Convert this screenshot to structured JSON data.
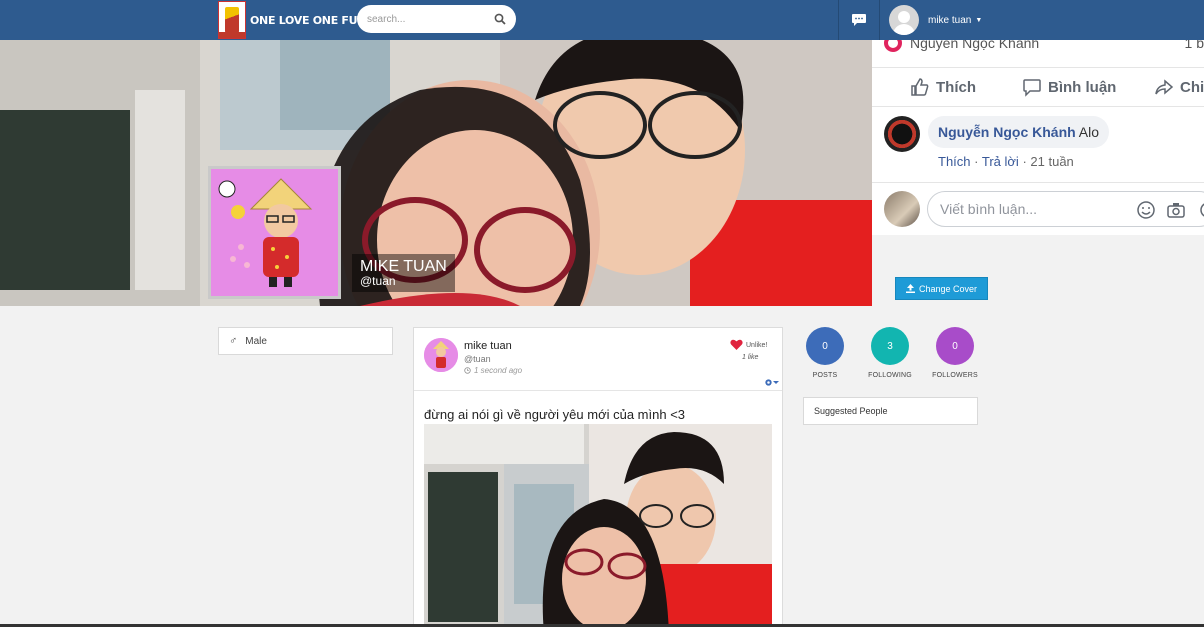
{
  "navbar": {
    "logo_text": "ONE LOVE ONE FUTURE",
    "search_placeholder": "search...",
    "user_name": "mike tuan",
    "colors": {
      "bar": "#2e5b8f"
    }
  },
  "profile": {
    "name": "MIKE TUAN",
    "handle": "@tuan",
    "change_cover_label": "Change Cover",
    "gender": "Male"
  },
  "fb_snippet": {
    "top_name": "Nguyễn Ngọc Khánh",
    "top_right": "1 b",
    "actions": [
      "Thích",
      "Bình luận",
      "Chi"
    ],
    "comment_author": "Nguyễn Ngọc Khánh",
    "comment_text": "Alo",
    "meta_like": "Thích",
    "meta_reply": "Trả lời",
    "meta_time": "21 tuần",
    "write_placeholder": "Viết bình luận..."
  },
  "post": {
    "author": "mike tuan",
    "handle": "@tuan",
    "time": "1 second ago",
    "unlike_label": "Unlike!",
    "likes": "1 like",
    "text": "đừng ai nói gì về người yêu mới của mình <3"
  },
  "stats": [
    {
      "value": "0",
      "label": "POSTS",
      "color": "#3d6cb9"
    },
    {
      "value": "3",
      "label": "FOLLOWING",
      "color": "#12b5b0"
    },
    {
      "value": "0",
      "label": "FOLLOWERS",
      "color": "#a84cc9"
    }
  ],
  "suggested_label": "Suggested People"
}
